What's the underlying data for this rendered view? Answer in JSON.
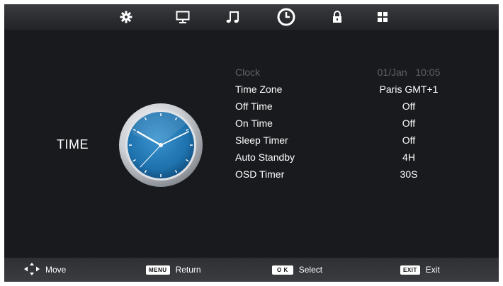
{
  "tabs": [
    {
      "name": "picture",
      "icon": "gear-icon",
      "active": false
    },
    {
      "name": "display",
      "icon": "monitor-icon",
      "active": false
    },
    {
      "name": "sound",
      "icon": "music-note-icon",
      "active": false
    },
    {
      "name": "time",
      "icon": "clock-icon",
      "active": true
    },
    {
      "name": "lock",
      "icon": "lock-icon",
      "active": false
    },
    {
      "name": "setup",
      "icon": "grid-icon",
      "active": false
    }
  ],
  "section": {
    "title": "TIME",
    "image_icon": "clock-face-icon"
  },
  "menu": {
    "items": [
      {
        "label": "Clock",
        "value": "01/Jan   10:05",
        "disabled": true
      },
      {
        "label": "Time Zone",
        "value": "Paris GMT+1"
      },
      {
        "label": "Off Time",
        "value": "Off"
      },
      {
        "label": "On Time",
        "value": "Off"
      },
      {
        "label": "Sleep Timer",
        "value": "Off"
      },
      {
        "label": "Auto Standby",
        "value": "4H"
      },
      {
        "label": "OSD Timer",
        "value": "30S"
      }
    ]
  },
  "footer": {
    "move": {
      "icon": "arrow-keys-icon",
      "label": "Move"
    },
    "return": {
      "key": "MENU",
      "label": "Return"
    },
    "select": {
      "key": "O K",
      "label": "Select"
    },
    "exit": {
      "key": "EXIT",
      "label": "Exit"
    }
  },
  "colors": {
    "background": "#181a1d",
    "bar": "#2e3034",
    "text": "#ffffff",
    "disabled_text": "#5e6166",
    "clock_face": "#1e72ad"
  }
}
